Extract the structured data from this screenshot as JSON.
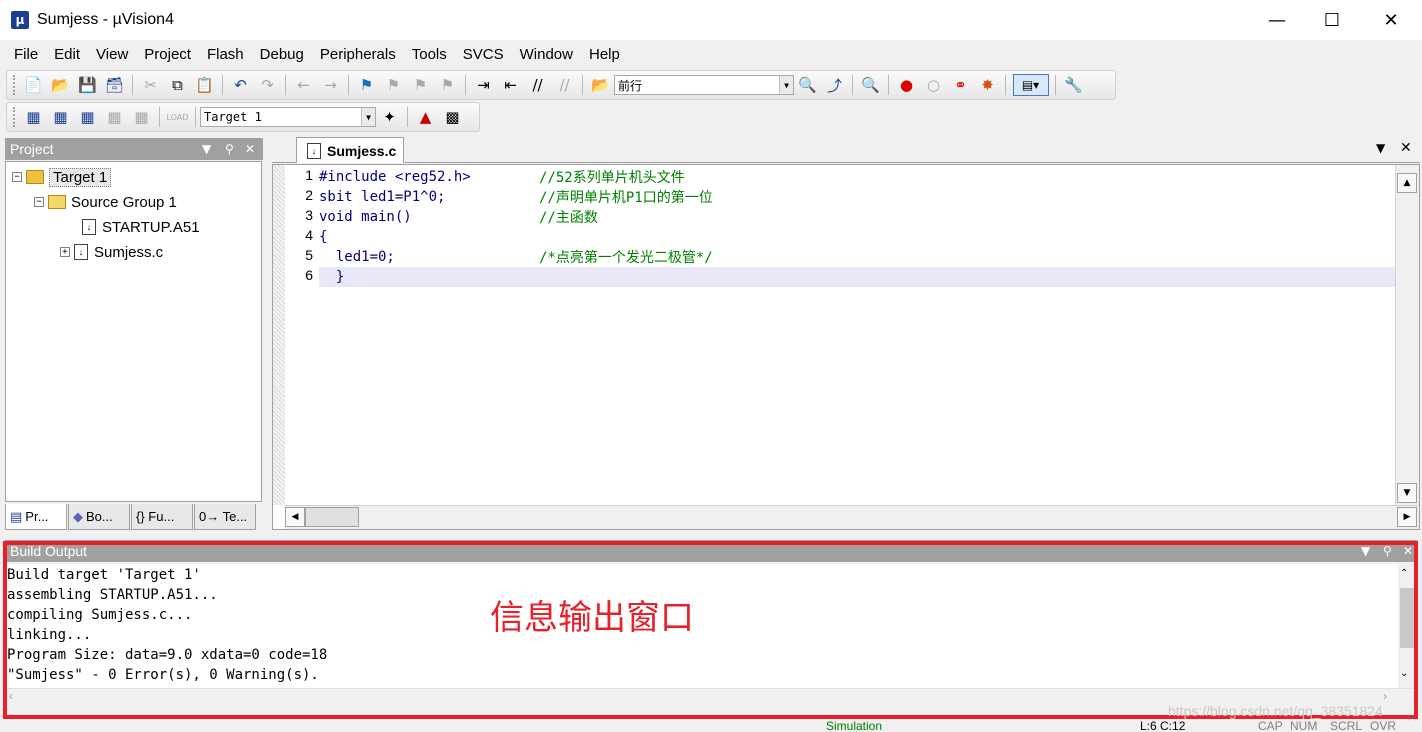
{
  "window": {
    "title": "Sumjess  - µVision4",
    "app_icon": "uv-icon"
  },
  "menu": [
    "File",
    "Edit",
    "View",
    "Project",
    "Flash",
    "Debug",
    "Peripherals",
    "Tools",
    "SVCS",
    "Window",
    "Help"
  ],
  "toolbar": {
    "find_combo_value": "前行",
    "target_combo_value": "Target 1"
  },
  "project_pane": {
    "title": "Project",
    "tree": {
      "target": "Target 1",
      "group": "Source Group 1",
      "files": [
        "STARTUP.A51",
        "Sumjess.c"
      ]
    },
    "tabs": [
      "Pr...",
      "Bo...",
      "{} Fu...",
      "0→ Te..."
    ]
  },
  "editor": {
    "active_tab": "Sumjess.c",
    "lines": [
      {
        "num": "1",
        "code": "#include <reg52.h>",
        "comment": "//52系列单片机头文件"
      },
      {
        "num": "2",
        "code": "sbit led1=P1^0;",
        "comment": "//声明单片机P1口的第一位"
      },
      {
        "num": "3",
        "code": "void main()",
        "comment": "//主函数"
      },
      {
        "num": "4",
        "code": "{",
        "comment": ""
      },
      {
        "num": "5",
        "code": "  led1=0;",
        "comment": "/*点亮第一个发光二极管*/"
      },
      {
        "num": "6",
        "code": "  }",
        "comment": ""
      }
    ]
  },
  "build_output": {
    "title": "Build Output",
    "lines": [
      "Build target 'Target 1'",
      "assembling STARTUP.A51...",
      "compiling Sumjess.c...",
      "linking...",
      "Program Size: data=9.0 xdata=0 code=18",
      "\"Sumjess\" - 0 Error(s), 0 Warning(s)."
    ],
    "annotation": "信息输出窗口"
  },
  "statusbar": {
    "mode": "Simulation",
    "position": "L:6 C:12",
    "caps": "CAP",
    "num": "NUM",
    "scrl": "SCRL",
    "ovr": "OVR"
  },
  "watermark": "https://blog.csdn.net/qq_38351824",
  "colors": {
    "keyword": "#000080",
    "comment": "#008000",
    "annotation": "#e8202a",
    "current_line": "#e8e8f8"
  }
}
